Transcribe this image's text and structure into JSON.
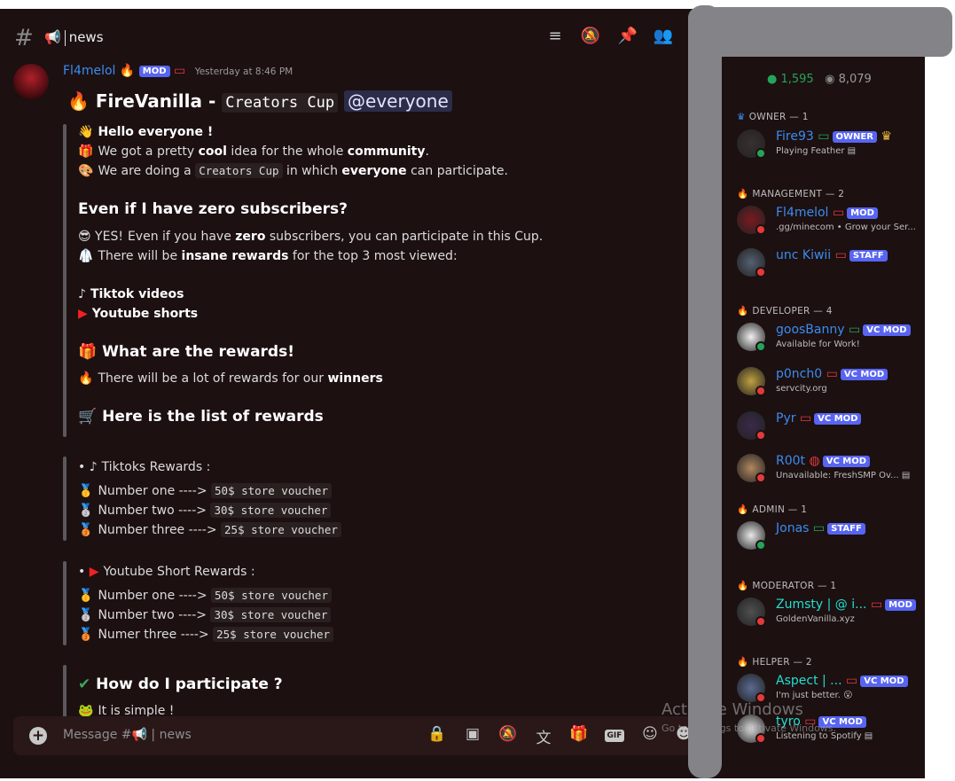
{
  "channel": {
    "hash": "#",
    "emoji": "📢",
    "name": "news"
  },
  "header_icons": [
    "threads-icon",
    "mute-bell-icon",
    "pin-icon",
    "members-icon"
  ],
  "message": {
    "author": "Fl4melol",
    "author_badge": "MOD",
    "timestamp": "Yesterday at 8:46 PM",
    "title_prefix": "FireVanilla -",
    "title_code": "Creators Cup",
    "title_mention": "@everyone",
    "lines": {
      "hello": {
        "emoji": "👋",
        "segs": [
          {
            "t": "Hello everyone !",
            "b": true
          }
        ]
      },
      "cool": {
        "emoji": "🎁",
        "segs": [
          {
            "t": "We got a pretty "
          },
          {
            "t": "cool",
            "b": true
          },
          {
            "t": " idea for the whole "
          },
          {
            "t": "community",
            "b": true
          },
          {
            "t": "."
          }
        ]
      },
      "doing": {
        "emoji": "🎨",
        "segs": [
          {
            "t": "We are doing a "
          },
          {
            "t": "Creators Cup",
            "c": true
          },
          {
            "t": " in which "
          },
          {
            "t": "everyone",
            "b": true
          },
          {
            "t": " can participate."
          }
        ]
      },
      "zero_h": "Even if I have zero subscribers?",
      "zero": {
        "emoji": "😎 YES!",
        "segs": [
          {
            "t": "Even if you have "
          },
          {
            "t": "zero",
            "b": true
          },
          {
            "t": " subscribers, you can participate in this Cup."
          }
        ]
      },
      "insane": {
        "emoji": "🥼",
        "segs": [
          {
            "t": "There will be "
          },
          {
            "t": "insane rewards",
            "b": true
          },
          {
            "t": " for the top 3 most viewed:"
          }
        ]
      },
      "tiktok": {
        "emoji": "♪",
        "segs": [
          {
            "t": "Tiktok videos",
            "b": true
          }
        ]
      },
      "youtube": {
        "emoji": "▶",
        "segs": [
          {
            "t": "Youtube shorts",
            "b": true
          }
        ]
      },
      "rewards_h": "What are the rewards!",
      "lot": {
        "emoji": "🔥",
        "segs": [
          {
            "t": "There will be a lot of rewards for our "
          },
          {
            "t": "winners",
            "b": true
          }
        ]
      },
      "list_h": "Here is the list of rewards",
      "tt_title": {
        "emoji": "♪",
        "segs": [
          {
            "t": "Tiktoks Rewards :"
          }
        ]
      },
      "tt1": {
        "emoji": "🥇",
        "segs": [
          {
            "t": "Number one ----> "
          },
          {
            "t": "50$ store voucher",
            "c": true
          }
        ]
      },
      "tt2": {
        "emoji": "🥈",
        "segs": [
          {
            "t": "Number two ----> "
          },
          {
            "t": "30$ store voucher",
            "c": true
          }
        ]
      },
      "tt3": {
        "emoji": "🥉",
        "segs": [
          {
            "t": "Number three ----> "
          },
          {
            "t": "25$ store voucher",
            "c": true
          }
        ]
      },
      "yt_title": {
        "emoji": "▶",
        "segs": [
          {
            "t": "Youtube Short Rewards :"
          }
        ]
      },
      "yt1": {
        "emoji": "🥇",
        "segs": [
          {
            "t": "Number one ----> "
          },
          {
            "t": "50$ store voucher",
            "c": true
          }
        ]
      },
      "yt2": {
        "emoji": "🥈",
        "segs": [
          {
            "t": "Number two ----> "
          },
          {
            "t": "30$ store voucher",
            "c": true
          }
        ]
      },
      "yt3": {
        "emoji": "🥉",
        "segs": [
          {
            "t": "Numer three ----> "
          },
          {
            "t": "25$ store voucher",
            "c": true
          }
        ]
      },
      "how_h": "How do I participate ?",
      "simple": {
        "emoji": "🐸",
        "segs": [
          {
            "t": "It is simple !"
          }
        ]
      }
    }
  },
  "composer": {
    "placeholder": "Message #📢 | news",
    "icons": [
      "lock-icon",
      "calendar-icon",
      "mute-icon",
      "translate-icon",
      "gift-icon",
      "gif-icon",
      "sticker-icon",
      "emoji-icon"
    ],
    "gif": "GIF"
  },
  "members": {
    "online": "1,595",
    "total": "8,079",
    "online_color": "#23a559",
    "sections": [
      {
        "title": "OWNER — 1",
        "icon": "♛",
        "members": [
          {
            "name": "Fire93",
            "device": "green",
            "badge": "OWNER",
            "extra": "♛",
            "sub": "Playing Feather ▤",
            "status": "on"
          }
        ]
      },
      {
        "title": "MANAGEMENT — 2",
        "icon": "🔥",
        "members": [
          {
            "name": "Fl4melol",
            "device": "red",
            "badge": "MOD",
            "sub": ".gg/minecom • Grow your Ser...",
            "status": "dnd"
          },
          {
            "name": "unc Kiwii",
            "device": "red",
            "badge": "STAFF",
            "sub": "",
            "status": "dnd"
          }
        ]
      },
      {
        "title": "DEVELOPER — 4",
        "icon": "🔥",
        "members": [
          {
            "name": "goosBanny",
            "device": "green",
            "badge": "VC MOD",
            "sub": "Available for Work!",
            "status": "on"
          },
          {
            "name": "p0nch0",
            "device": "red",
            "badge": "VC MOD",
            "sub": "servcity.org",
            "status": "dnd"
          },
          {
            "name": "Pyr",
            "device": "red",
            "badge": "VC MOD",
            "sub": "",
            "status": "dnd"
          },
          {
            "name": "R00t",
            "device": "globe",
            "badge": "VC MOD",
            "sub": "Unavailable: FreshSMP Ov... ▤",
            "status": "dnd"
          }
        ]
      },
      {
        "title": "ADMIN — 1",
        "icon": "🔥",
        "members": [
          {
            "name": "Jonas",
            "device": "green",
            "badge": "STAFF",
            "sub": "",
            "status": "on"
          }
        ]
      },
      {
        "title": "MODERATOR — 1",
        "icon": "🔥",
        "members": [
          {
            "name": "Zumsty | @ i...",
            "device": "red",
            "badge": "MOD",
            "sub": "GoldenVanilla.xyz",
            "status": "dnd",
            "cyan": true
          }
        ]
      },
      {
        "title": "HELPER — 2",
        "icon": "🔥",
        "members": [
          {
            "name": "Aspect | ...",
            "device": "red",
            "badge": "VC MOD",
            "sub": "I'm just better. 😮",
            "status": "dnd",
            "cyan": true
          },
          {
            "name": "tyro",
            "device": "red",
            "badge": "VC MOD",
            "sub": "Listening to Spotify ▤",
            "status": "dnd",
            "cyan": true
          }
        ]
      }
    ]
  },
  "watermark": {
    "title": "Activate Windows",
    "sub": "Go to Settings to activate Windows."
  }
}
